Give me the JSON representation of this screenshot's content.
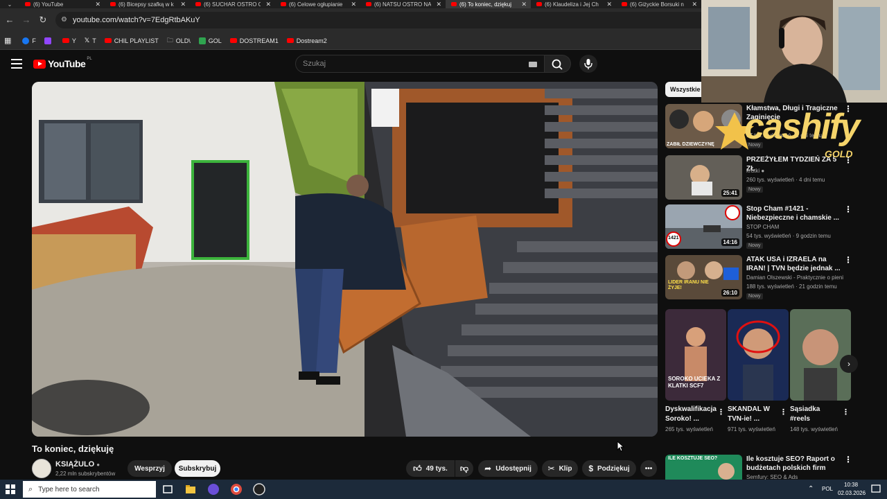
{
  "browser": {
    "tabs": [
      {
        "title": "(6) YouTube",
        "active": false
      },
      {
        "title": "(6) Bicepsy szafką w k",
        "active": false
      },
      {
        "title": "(6) SUCHAR OSTRO C",
        "active": false
      },
      {
        "title": "(6) Celowe ogłupianie",
        "active": false
      },
      {
        "title": "(6) NATSU OSTRO NA",
        "active": false
      },
      {
        "title": "(6) To koniec, dziękuj",
        "active": true
      },
      {
        "title": "(6) Klaudeliza i Jej Ch",
        "active": false
      },
      {
        "title": "(6) Giżyckie Borsuki n",
        "active": false
      }
    ],
    "url": "youtube.com/watch?v=7EdgRtbAKuY",
    "bookmarks": [
      {
        "label": "F",
        "color": "#1877f2"
      },
      {
        "label": "Y",
        "color": "#ff0000"
      },
      {
        "label": "T",
        "color": "#ffffff"
      },
      {
        "label": "CHIL PLAYLIST",
        "color": "#ff0000"
      },
      {
        "label": "OLD\\",
        "color": "#888888"
      },
      {
        "label": "GOL",
        "color": "#2fa44f"
      },
      {
        "label": "DOSTREAM1",
        "color": "#ff0000"
      },
      {
        "label": "Dostream2",
        "color": "#ff0000"
      }
    ]
  },
  "youtube": {
    "logo_text": "YouTube",
    "country": "PL",
    "search_placeholder": "Szukaj"
  },
  "video": {
    "title": "To koniec, dziękuję",
    "channel": "KSIĄŻULO",
    "subscribers": "2,22 mln subskrybentów",
    "support_label": "Wesprzyj",
    "subscribe_label": "Subskrybuj",
    "likes": "49 tys.",
    "share_label": "Udostępnij",
    "clip_label": "Klip",
    "thanks_label": "Podziękuj"
  },
  "sidebar": {
    "chip": "Wszystkie",
    "recommendations": [
      {
        "title": "Kłamstwa, Długi i Tragiczne Zaginięcie",
        "channel": "",
        "meta": "17 tys. wyświetleń · 2 dni temu",
        "badge": "Nowy",
        "duration": "",
        "thumb_text": "ZABIŁ DZIEWCZYNĘ"
      },
      {
        "title": "PRZEŻYŁEM TYDZIEŃ ZA 5 ZŁ",
        "channel": "krutki",
        "meta": "260 tys. wyświetleń · 4 dni temu",
        "badge": "Nowy",
        "duration": "25:41",
        "thumb_text": ""
      },
      {
        "title": "Stop Cham #1421 - Niebezpieczne i chamskie ...",
        "channel": "STOP CHAM",
        "meta": "54 tys. wyświetleń · 9 godzin temu",
        "badge": "Nowy",
        "duration": "14:16",
        "thumb_text": "1421"
      },
      {
        "title": "ATAK USA i IZRAELA na IRAN! | TVN będzie jednak ...",
        "channel": "Damian Olszewski - Praktycznie o pienię...",
        "meta": "188 tys. wyświetleń · 21 godzin temu",
        "badge": "Nowy",
        "duration": "26:10",
        "thumb_text": "LIDER IRANU NIE ŻYJE!"
      },
      {
        "title": "Ile kosztuje SEO? Raport o budżetach polskich firm",
        "channel": "Semfury: SEO & Ads",
        "meta": "",
        "badge": "",
        "duration": "",
        "thumb_text": "ILE KOSZTUJE SEO?"
      }
    ],
    "shorts": [
      {
        "title": "Dyskwalifikacja Soroko! ...",
        "views": "265 tys. wyświetleń",
        "thumb_text": "SOROKO UCIEKA Z KLATKI SCF7"
      },
      {
        "title": "SKANDAL W TVN-ie! ...",
        "views": "971 tys. wyświetleń",
        "thumb_text": ""
      },
      {
        "title": "Sąsiadka #reels",
        "views": "148 tys. wyświetleń",
        "thumb_text": ""
      }
    ]
  },
  "overlay": {
    "brand": "cashify",
    "brand_sub": "GOLD"
  },
  "taskbar": {
    "search_placeholder": "Type here to search",
    "language": "POL",
    "time": "10:38",
    "date": "02.03.2026"
  }
}
